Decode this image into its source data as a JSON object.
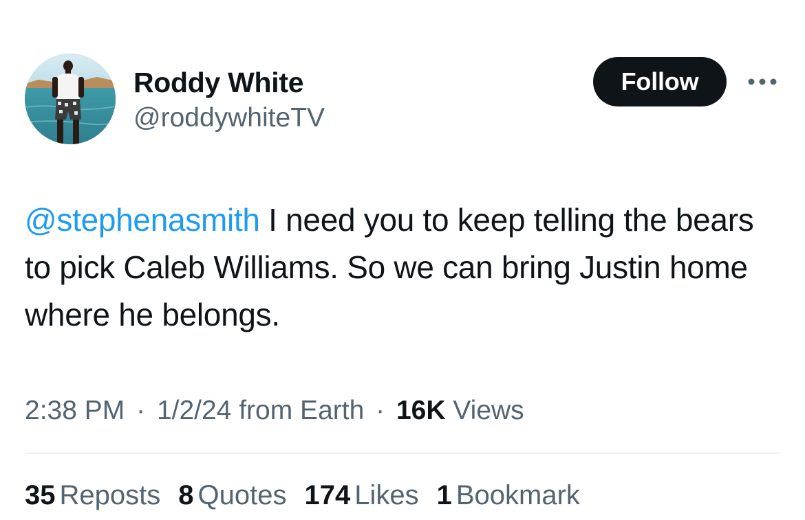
{
  "author": {
    "display_name": "Roddy White",
    "handle": "@roddywhiteTV",
    "avatar_icon": "profile-photo"
  },
  "actions": {
    "follow_label": "Follow",
    "more_icon": "more-dots-icon"
  },
  "tweet": {
    "mention": "@stephenasmith",
    "body": " I need you to keep telling the bears to pick Caleb Williams. So we can bring Justin home where he belongs."
  },
  "meta": {
    "time": "2:38 PM",
    "separator": "·",
    "date": "1/2/24",
    "source": "from Earth",
    "views_count": "16K",
    "views_label": "Views"
  },
  "stats": [
    {
      "count": "35",
      "label": "Reposts"
    },
    {
      "count": "8",
      "label": "Quotes"
    },
    {
      "count": "174",
      "label": "Likes"
    },
    {
      "count": "1",
      "label": "Bookmark"
    }
  ],
  "colors": {
    "text_primary": "#0f1419",
    "text_secondary": "#536471",
    "link": "#1d9bf0",
    "follow_bg": "#0f1419",
    "divider": "#cfd9de"
  }
}
